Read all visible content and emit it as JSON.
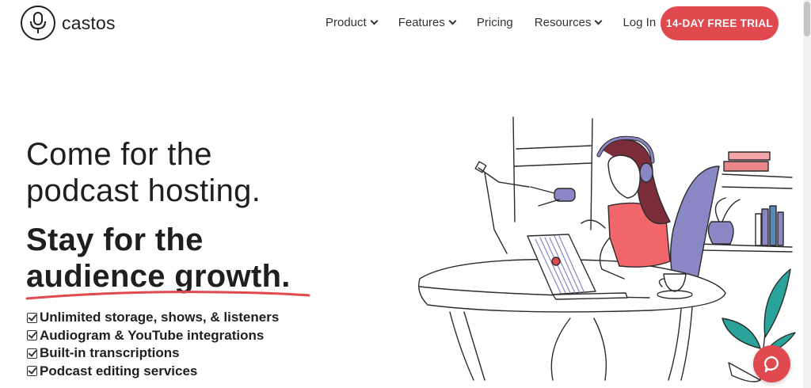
{
  "header": {
    "logo_text": "castos",
    "nav": [
      {
        "label": "Product",
        "dropdown": true
      },
      {
        "label": "Features",
        "dropdown": true
      },
      {
        "label": "Pricing",
        "dropdown": false
      },
      {
        "label": "Resources",
        "dropdown": true
      },
      {
        "label": "Log In",
        "dropdown": false
      }
    ],
    "cta_label": "14-DAY FREE TRIAL"
  },
  "hero": {
    "line1": "Come for the",
    "line2": "podcast hosting.",
    "line3": "Stay for the",
    "line4": "audience growth.",
    "features": [
      "Unlimited storage, shows, & listeners",
      "Audiogram & YouTube integrations",
      "Built-in transcriptions",
      "Podcast editing services"
    ]
  },
  "colors": {
    "accent": "#e04a4f",
    "text": "#1f1f1f",
    "illustration_purple": "#8a87c4",
    "illustration_teal": "#2aa39a"
  },
  "icons": {
    "logo": "microphone-icon",
    "check": "checkbox-checked-icon",
    "chat": "chat-bubble-icon"
  }
}
